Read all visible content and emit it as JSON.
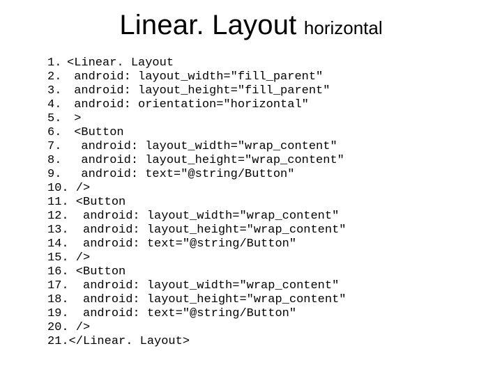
{
  "title": {
    "main": "Linear. Layout",
    "sub": "horizontal"
  },
  "code": {
    "lines": [
      {
        "n": "1.",
        "t": "<Linear. Layout"
      },
      {
        "n": "2.",
        "t": " android: layout_width=\"fill_parent\""
      },
      {
        "n": "3.",
        "t": " android: layout_height=\"fill_parent\""
      },
      {
        "n": "4.",
        "t": " android: orientation=\"horizontal\""
      },
      {
        "n": "5.",
        "t": " >"
      },
      {
        "n": "6.",
        "t": " <Button"
      },
      {
        "n": "7.",
        "t": "  android: layout_width=\"wrap_content\""
      },
      {
        "n": "8.",
        "t": "  android: layout_height=\"wrap_content\""
      },
      {
        "n": "9.",
        "t": "  android: text=\"@string/Button\""
      },
      {
        "n": "10.",
        "t": " />"
      },
      {
        "n": "11.",
        "t": " <Button"
      },
      {
        "n": "12.",
        "t": "  android: layout_width=\"wrap_content\""
      },
      {
        "n": "13.",
        "t": "  android: layout_height=\"wrap_content\""
      },
      {
        "n": "14.",
        "t": "  android: text=\"@string/Button\""
      },
      {
        "n": "15.",
        "t": " />"
      },
      {
        "n": "16.",
        "t": " <Button"
      },
      {
        "n": "17.",
        "t": "  android: layout_width=\"wrap_content\""
      },
      {
        "n": "18.",
        "t": "  android: layout_height=\"wrap_content\""
      },
      {
        "n": "19.",
        "t": "  android: text=\"@string/Button\""
      },
      {
        "n": "20.",
        "t": " />"
      },
      {
        "n": "21.",
        "t": "</Linear. Layout>"
      }
    ]
  }
}
